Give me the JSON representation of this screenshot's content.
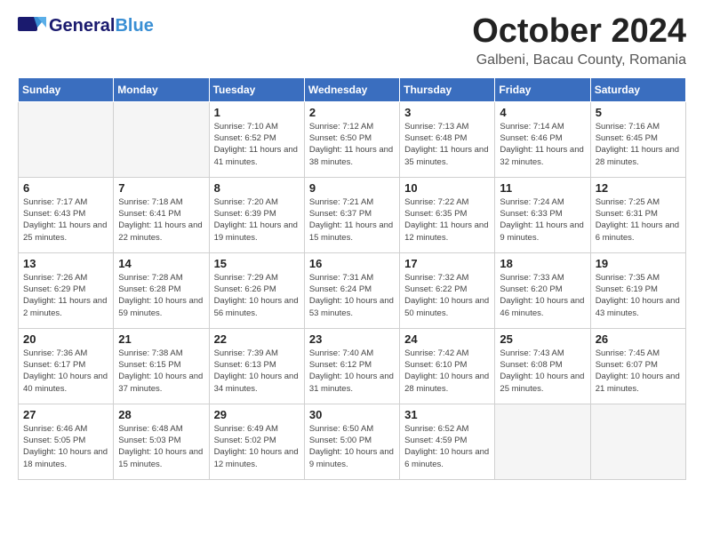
{
  "header": {
    "logo_general": "General",
    "logo_blue": "Blue",
    "month_title": "October 2024",
    "subtitle": "Galbeni, Bacau County, Romania"
  },
  "weekdays": [
    "Sunday",
    "Monday",
    "Tuesday",
    "Wednesday",
    "Thursday",
    "Friday",
    "Saturday"
  ],
  "weeks": [
    [
      {
        "day": "",
        "sunrise": "",
        "sunset": "",
        "daylight": ""
      },
      {
        "day": "",
        "sunrise": "",
        "sunset": "",
        "daylight": ""
      },
      {
        "day": "1",
        "sunrise": "Sunrise: 7:10 AM",
        "sunset": "Sunset: 6:52 PM",
        "daylight": "Daylight: 11 hours and 41 minutes."
      },
      {
        "day": "2",
        "sunrise": "Sunrise: 7:12 AM",
        "sunset": "Sunset: 6:50 PM",
        "daylight": "Daylight: 11 hours and 38 minutes."
      },
      {
        "day": "3",
        "sunrise": "Sunrise: 7:13 AM",
        "sunset": "Sunset: 6:48 PM",
        "daylight": "Daylight: 11 hours and 35 minutes."
      },
      {
        "day": "4",
        "sunrise": "Sunrise: 7:14 AM",
        "sunset": "Sunset: 6:46 PM",
        "daylight": "Daylight: 11 hours and 32 minutes."
      },
      {
        "day": "5",
        "sunrise": "Sunrise: 7:16 AM",
        "sunset": "Sunset: 6:45 PM",
        "daylight": "Daylight: 11 hours and 28 minutes."
      }
    ],
    [
      {
        "day": "6",
        "sunrise": "Sunrise: 7:17 AM",
        "sunset": "Sunset: 6:43 PM",
        "daylight": "Daylight: 11 hours and 25 minutes."
      },
      {
        "day": "7",
        "sunrise": "Sunrise: 7:18 AM",
        "sunset": "Sunset: 6:41 PM",
        "daylight": "Daylight: 11 hours and 22 minutes."
      },
      {
        "day": "8",
        "sunrise": "Sunrise: 7:20 AM",
        "sunset": "Sunset: 6:39 PM",
        "daylight": "Daylight: 11 hours and 19 minutes."
      },
      {
        "day": "9",
        "sunrise": "Sunrise: 7:21 AM",
        "sunset": "Sunset: 6:37 PM",
        "daylight": "Daylight: 11 hours and 15 minutes."
      },
      {
        "day": "10",
        "sunrise": "Sunrise: 7:22 AM",
        "sunset": "Sunset: 6:35 PM",
        "daylight": "Daylight: 11 hours and 12 minutes."
      },
      {
        "day": "11",
        "sunrise": "Sunrise: 7:24 AM",
        "sunset": "Sunset: 6:33 PM",
        "daylight": "Daylight: 11 hours and 9 minutes."
      },
      {
        "day": "12",
        "sunrise": "Sunrise: 7:25 AM",
        "sunset": "Sunset: 6:31 PM",
        "daylight": "Daylight: 11 hours and 6 minutes."
      }
    ],
    [
      {
        "day": "13",
        "sunrise": "Sunrise: 7:26 AM",
        "sunset": "Sunset: 6:29 PM",
        "daylight": "Daylight: 11 hours and 2 minutes."
      },
      {
        "day": "14",
        "sunrise": "Sunrise: 7:28 AM",
        "sunset": "Sunset: 6:28 PM",
        "daylight": "Daylight: 10 hours and 59 minutes."
      },
      {
        "day": "15",
        "sunrise": "Sunrise: 7:29 AM",
        "sunset": "Sunset: 6:26 PM",
        "daylight": "Daylight: 10 hours and 56 minutes."
      },
      {
        "day": "16",
        "sunrise": "Sunrise: 7:31 AM",
        "sunset": "Sunset: 6:24 PM",
        "daylight": "Daylight: 10 hours and 53 minutes."
      },
      {
        "day": "17",
        "sunrise": "Sunrise: 7:32 AM",
        "sunset": "Sunset: 6:22 PM",
        "daylight": "Daylight: 10 hours and 50 minutes."
      },
      {
        "day": "18",
        "sunrise": "Sunrise: 7:33 AM",
        "sunset": "Sunset: 6:20 PM",
        "daylight": "Daylight: 10 hours and 46 minutes."
      },
      {
        "day": "19",
        "sunrise": "Sunrise: 7:35 AM",
        "sunset": "Sunset: 6:19 PM",
        "daylight": "Daylight: 10 hours and 43 minutes."
      }
    ],
    [
      {
        "day": "20",
        "sunrise": "Sunrise: 7:36 AM",
        "sunset": "Sunset: 6:17 PM",
        "daylight": "Daylight: 10 hours and 40 minutes."
      },
      {
        "day": "21",
        "sunrise": "Sunrise: 7:38 AM",
        "sunset": "Sunset: 6:15 PM",
        "daylight": "Daylight: 10 hours and 37 minutes."
      },
      {
        "day": "22",
        "sunrise": "Sunrise: 7:39 AM",
        "sunset": "Sunset: 6:13 PM",
        "daylight": "Daylight: 10 hours and 34 minutes."
      },
      {
        "day": "23",
        "sunrise": "Sunrise: 7:40 AM",
        "sunset": "Sunset: 6:12 PM",
        "daylight": "Daylight: 10 hours and 31 minutes."
      },
      {
        "day": "24",
        "sunrise": "Sunrise: 7:42 AM",
        "sunset": "Sunset: 6:10 PM",
        "daylight": "Daylight: 10 hours and 28 minutes."
      },
      {
        "day": "25",
        "sunrise": "Sunrise: 7:43 AM",
        "sunset": "Sunset: 6:08 PM",
        "daylight": "Daylight: 10 hours and 25 minutes."
      },
      {
        "day": "26",
        "sunrise": "Sunrise: 7:45 AM",
        "sunset": "Sunset: 6:07 PM",
        "daylight": "Daylight: 10 hours and 21 minutes."
      }
    ],
    [
      {
        "day": "27",
        "sunrise": "Sunrise: 6:46 AM",
        "sunset": "Sunset: 5:05 PM",
        "daylight": "Daylight: 10 hours and 18 minutes."
      },
      {
        "day": "28",
        "sunrise": "Sunrise: 6:48 AM",
        "sunset": "Sunset: 5:03 PM",
        "daylight": "Daylight: 10 hours and 15 minutes."
      },
      {
        "day": "29",
        "sunrise": "Sunrise: 6:49 AM",
        "sunset": "Sunset: 5:02 PM",
        "daylight": "Daylight: 10 hours and 12 minutes."
      },
      {
        "day": "30",
        "sunrise": "Sunrise: 6:50 AM",
        "sunset": "Sunset: 5:00 PM",
        "daylight": "Daylight: 10 hours and 9 minutes."
      },
      {
        "day": "31",
        "sunrise": "Sunrise: 6:52 AM",
        "sunset": "Sunset: 4:59 PM",
        "daylight": "Daylight: 10 hours and 6 minutes."
      },
      {
        "day": "",
        "sunrise": "",
        "sunset": "",
        "daylight": ""
      },
      {
        "day": "",
        "sunrise": "",
        "sunset": "",
        "daylight": ""
      }
    ]
  ]
}
